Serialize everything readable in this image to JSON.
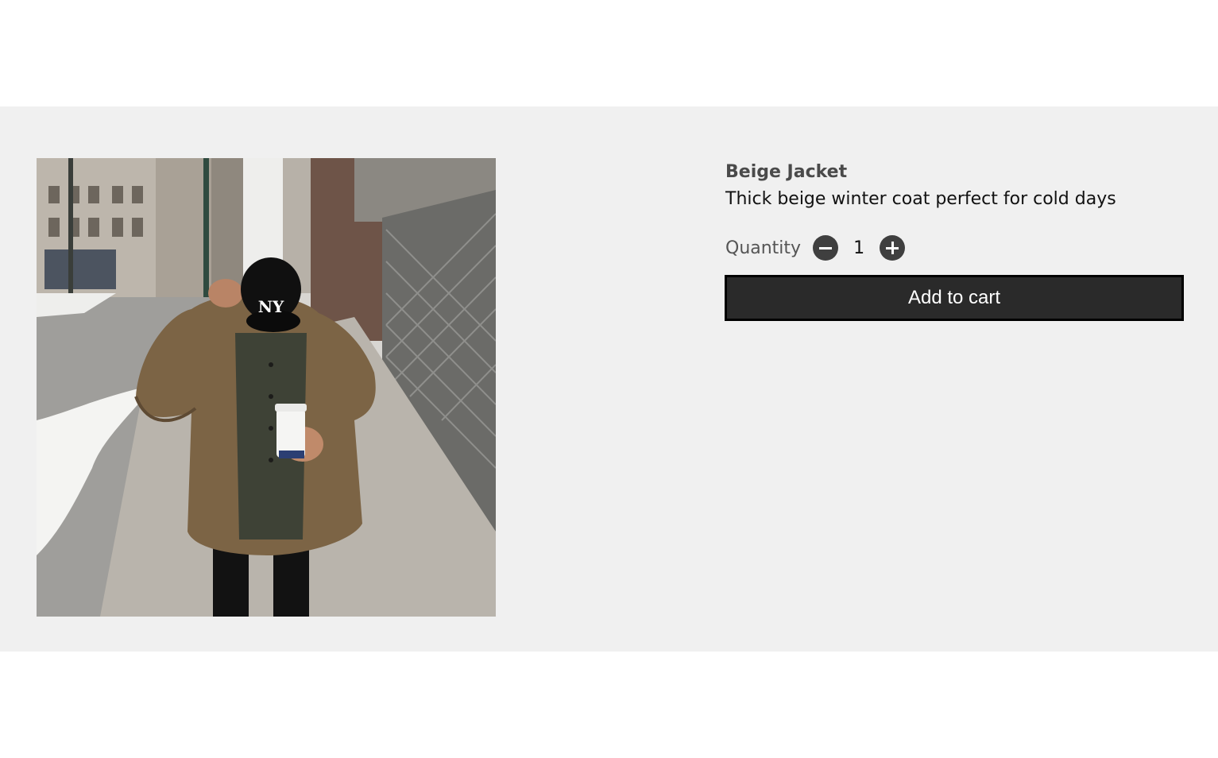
{
  "product": {
    "name": "Beige Jacket",
    "description": "Thick beige winter coat perfect for cold days",
    "quantity_label": "Quantity",
    "quantity": "1",
    "decrease_icon": "minus-circle-icon",
    "increase_icon": "plus-circle-icon",
    "add_to_cart_label": "Add to cart",
    "image_alt": "Person in a beige puffer jacket holding a coffee cup on a snowy city sidewalk"
  },
  "colors": {
    "section_background": "#f0f0f0",
    "button_background": "#2a2a2a",
    "qty_button": "#3f3f3f"
  }
}
